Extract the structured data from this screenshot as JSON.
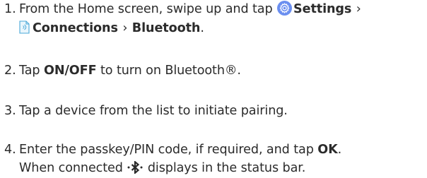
{
  "steps": [
    {
      "number": "1.",
      "pre": "From the Home screen, swipe up and tap",
      "settings": "Settings",
      "sep": "›",
      "connections": "Connections",
      "bluetooth": "Bluetooth",
      "end": ".",
      "icons": [
        "settings-gear-icon",
        "connections-icon"
      ]
    },
    {
      "number": "2.",
      "pre": "Tap",
      "bold": "ON/OFF",
      "post": "to turn on Bluetooth®."
    },
    {
      "number": "3.",
      "text": "Tap a device from the list to initiate pairing."
    },
    {
      "number": "4.",
      "pre": "Enter the passkey/PIN code, if required, and tap",
      "bold": "OK",
      "end": ".",
      "line2_pre": "When connected",
      "line2_post": "displays in the status bar.",
      "icons": [
        "bluetooth-connected-icon"
      ]
    }
  ],
  "colors": {
    "text": "#2b2b2b",
    "gear_bg": "#6b8ff0",
    "connections_icon": "#4aa8d8"
  }
}
